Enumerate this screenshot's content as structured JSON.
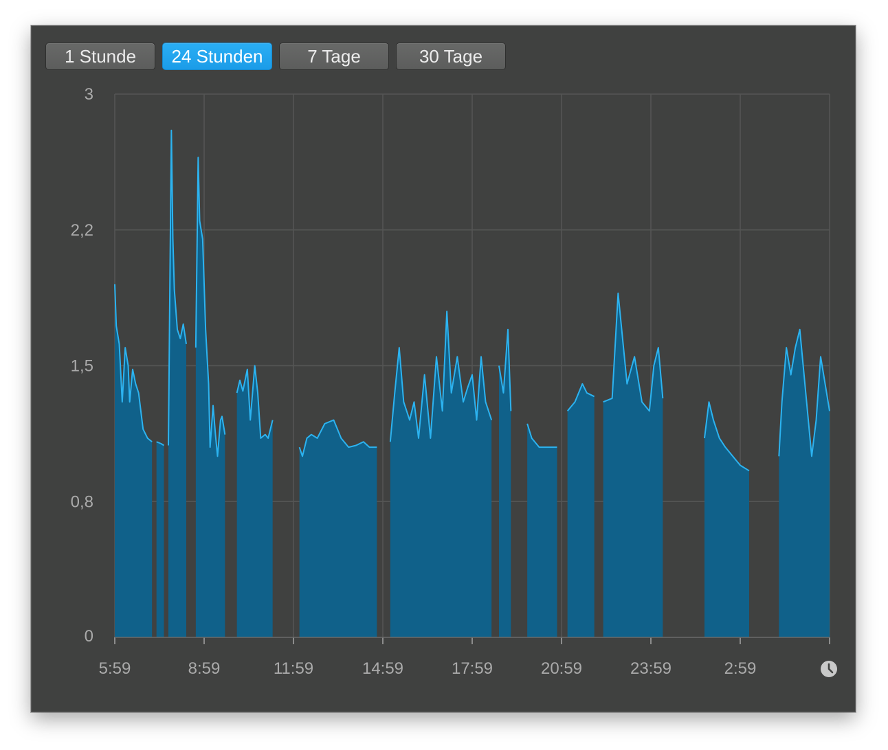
{
  "tabs": [
    {
      "label": "1 Stunde",
      "active": false
    },
    {
      "label": "24 Stunden",
      "active": true
    },
    {
      "label": "7 Tage",
      "active": false
    },
    {
      "label": "30 Tage",
      "active": false
    }
  ],
  "icons": {
    "time_axis": "clock-icon"
  },
  "colors": {
    "background": "#404140",
    "grid": "#555655",
    "area_fill": "#10618a",
    "line": "#2cb3f0",
    "active_tab": "#1ea3ee",
    "tick_text": "#aaaaaa"
  },
  "chart_data": {
    "type": "area",
    "title": "",
    "xlabel": "",
    "ylabel": "",
    "x_ticks": [
      "5:59",
      "8:59",
      "11:59",
      "14:59",
      "17:59",
      "20:59",
      "23:59",
      "2:59"
    ],
    "y_ticks": [
      "0",
      "0,8",
      "1,5",
      "2,2",
      "3"
    ],
    "x_range_hours": [
      0,
      24
    ],
    "ylim": [
      0,
      3
    ],
    "grid": true,
    "series": [
      {
        "color": "#2cb3f0",
        "segments": [
          [
            [
              0.0,
              1.95
            ],
            [
              0.05,
              1.72
            ],
            [
              0.15,
              1.62
            ],
            [
              0.25,
              1.3
            ],
            [
              0.35,
              1.6
            ],
            [
              0.45,
              1.5
            ],
            [
              0.5,
              1.3
            ],
            [
              0.6,
              1.48
            ],
            [
              0.7,
              1.4
            ],
            [
              0.8,
              1.35
            ],
            [
              0.95,
              1.15
            ],
            [
              1.1,
              1.1
            ],
            [
              1.25,
              1.08
            ]
          ],
          [
            [
              1.4,
              1.08
            ],
            [
              1.55,
              1.07
            ],
            [
              1.65,
              1.06
            ]
          ],
          [
            [
              1.8,
              1.06
            ],
            [
              1.9,
              2.8
            ],
            [
              1.95,
              2.2
            ],
            [
              2.0,
              1.92
            ],
            [
              2.1,
              1.7
            ],
            [
              2.2,
              1.65
            ],
            [
              2.3,
              1.73
            ],
            [
              2.4,
              1.62
            ]
          ],
          [
            [
              2.72,
              1.6
            ],
            [
              2.8,
              2.65
            ],
            [
              2.85,
              2.3
            ],
            [
              2.95,
              2.2
            ],
            [
              3.05,
              1.7
            ],
            [
              3.15,
              1.4
            ],
            [
              3.2,
              1.05
            ],
            [
              3.3,
              1.28
            ],
            [
              3.38,
              1.12
            ],
            [
              3.45,
              1.0
            ],
            [
              3.55,
              1.2
            ],
            [
              3.6,
              1.22
            ],
            [
              3.7,
              1.12
            ]
          ],
          [
            [
              4.1,
              1.35
            ],
            [
              4.2,
              1.42
            ],
            [
              4.3,
              1.36
            ],
            [
              4.45,
              1.48
            ],
            [
              4.55,
              1.2
            ],
            [
              4.7,
              1.5
            ],
            [
              4.8,
              1.35
            ],
            [
              4.9,
              1.1
            ],
            [
              5.05,
              1.12
            ],
            [
              5.15,
              1.1
            ],
            [
              5.3,
              1.2
            ]
          ],
          [
            [
              6.2,
              1.05
            ],
            [
              6.3,
              1.0
            ],
            [
              6.45,
              1.1
            ],
            [
              6.6,
              1.12
            ],
            [
              6.8,
              1.1
            ],
            [
              7.05,
              1.18
            ],
            [
              7.35,
              1.2
            ],
            [
              7.6,
              1.1
            ],
            [
              7.85,
              1.05
            ],
            [
              8.1,
              1.06
            ],
            [
              8.35,
              1.08
            ],
            [
              8.55,
              1.05
            ],
            [
              8.8,
              1.05
            ]
          ],
          [
            [
              9.25,
              1.08
            ],
            [
              9.4,
              1.35
            ],
            [
              9.55,
              1.6
            ],
            [
              9.7,
              1.3
            ],
            [
              9.9,
              1.2
            ],
            [
              10.05,
              1.3
            ],
            [
              10.2,
              1.1
            ],
            [
              10.4,
              1.45
            ],
            [
              10.6,
              1.1
            ],
            [
              10.8,
              1.55
            ],
            [
              11.0,
              1.25
            ],
            [
              11.15,
              1.8
            ],
            [
              11.3,
              1.35
            ],
            [
              11.5,
              1.55
            ],
            [
              11.7,
              1.3
            ],
            [
              11.85,
              1.38
            ],
            [
              12.0,
              1.45
            ],
            [
              12.15,
              1.2
            ],
            [
              12.3,
              1.55
            ],
            [
              12.45,
              1.3
            ],
            [
              12.65,
              1.2
            ]
          ],
          [
            [
              12.9,
              1.5
            ],
            [
              13.05,
              1.35
            ],
            [
              13.2,
              1.7
            ],
            [
              13.3,
              1.25
            ]
          ],
          [
            [
              13.85,
              1.18
            ],
            [
              14.0,
              1.1
            ],
            [
              14.25,
              1.05
            ],
            [
              14.55,
              1.05
            ],
            [
              14.85,
              1.05
            ]
          ],
          [
            [
              15.2,
              1.25
            ],
            [
              15.45,
              1.3
            ],
            [
              15.7,
              1.4
            ],
            [
              15.85,
              1.35
            ],
            [
              16.1,
              1.33
            ]
          ],
          [
            [
              16.4,
              1.3
            ],
            [
              16.7,
              1.32
            ],
            [
              16.9,
              1.9
            ],
            [
              17.05,
              1.65
            ],
            [
              17.2,
              1.4
            ],
            [
              17.45,
              1.55
            ],
            [
              17.7,
              1.3
            ],
            [
              17.95,
              1.25
            ],
            [
              18.1,
              1.5
            ],
            [
              18.25,
              1.6
            ],
            [
              18.4,
              1.32
            ]
          ],
          [
            [
              19.8,
              1.1
            ],
            [
              19.95,
              1.3
            ],
            [
              20.1,
              1.2
            ],
            [
              20.3,
              1.1
            ],
            [
              20.5,
              1.05
            ],
            [
              21.0,
              0.95
            ],
            [
              21.3,
              0.92
            ]
          ],
          [
            [
              22.3,
              1.0
            ],
            [
              22.4,
              1.3
            ],
            [
              22.55,
              1.6
            ],
            [
              22.7,
              1.45
            ],
            [
              22.85,
              1.6
            ],
            [
              23.0,
              1.7
            ],
            [
              23.2,
              1.35
            ],
            [
              23.4,
              1.0
            ],
            [
              23.55,
              1.2
            ],
            [
              23.7,
              1.55
            ],
            [
              23.85,
              1.4
            ],
            [
              24.0,
              1.25
            ]
          ]
        ]
      }
    ]
  }
}
